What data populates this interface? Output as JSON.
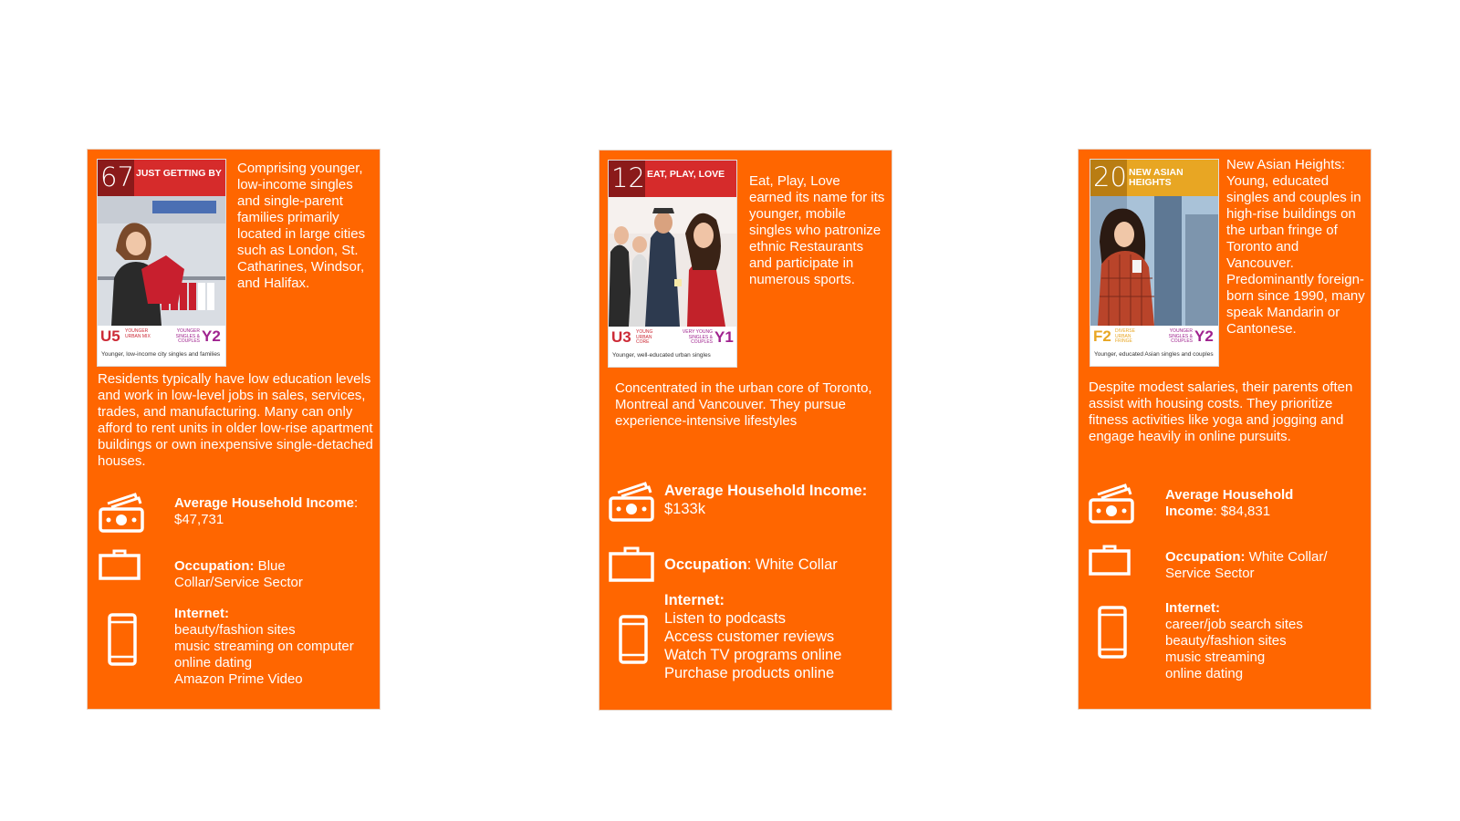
{
  "cards": [
    {
      "number": "67",
      "name": "JUST GETTING BY",
      "banner_color": "#d62b2b",
      "left_code": "U5",
      "left_code_sub": "YOUNGER URBAN MIX",
      "left_color": "#cc2a36",
      "right_code": "Y2",
      "right_code_sub": "YOUNGER SINGLES & COUPLES",
      "right_color": "#a0238f",
      "caption": "Younger, low-income city singles and families",
      "description": "Comprising younger, low-income singles and single-parent families primarily located in large cities such as London, St. Catharines, Windsor, and Halifax.",
      "paragraph": "Residents typically have low education levels and work in low-level jobs in sales, services, trades, and manufacturing. Many can only afford to rent units in older low-rise apartment buildings or own inexpensive single-detached houses.",
      "income_label": "Average Household Income",
      "income_value": ": $47,731",
      "occupation_label": "Occupation:",
      "occupation_value": " Blue Collar/Service Sector",
      "internet_label": "Internet:",
      "internet_items": [
        "beauty/fashion sites",
        "music streaming on computer",
        "online dating",
        "Amazon Prime Video"
      ]
    },
    {
      "number": "12",
      "name": "EAT, PLAY, LOVE",
      "banner_color": "#d62b2b",
      "left_code": "U3",
      "left_code_sub": "YOUNG URBAN CORE",
      "left_color": "#cc2a36",
      "right_code": "Y1",
      "right_code_sub": "VERY YOUNG SINGLES & COUPLES",
      "right_color": "#a0238f",
      "caption": "Younger, well-educated urban singles",
      "description": "Eat, Play, Love earned its name for its younger, mobile singles who patronize ethnic Restaurants and participate in numerous sports.",
      "paragraph": "Concentrated in the urban core of Toronto, Montreal and Vancouver. They pursue experience-intensive lifestyles",
      "income_label": "Average Household Income:",
      "income_value": "$133k",
      "occupation_label": "Occupation",
      "occupation_value": ": White Collar",
      "internet_label": "Internet:",
      "internet_items": [
        "Listen to podcasts",
        "Access customer reviews",
        "Watch TV programs online",
        "Purchase products online"
      ]
    },
    {
      "number": "20",
      "name": "NEW ASIAN HEIGHTS",
      "banner_color": "#e8a623",
      "left_code": "F2",
      "left_code_sub": "DIVERSE URBAN FRINGE",
      "left_color": "#e8a623",
      "right_code": "Y2",
      "right_code_sub": "YOUNGER SINGLES & COUPLES",
      "right_color": "#a0238f",
      "caption": "Younger, educated Asian singles and couples",
      "description": "New Asian Heights: Young, educated singles and couples in high-rise buildings on the urban fringe of Toronto and Vancouver. Predominantly foreign-born since 1990, many speak Mandarin or Cantonese.",
      "paragraph": "Despite modest salaries, their parents often assist with housing costs. They prioritize fitness activities like yoga and jogging and engage heavily in online pursuits.",
      "income_label": "Average Household Income",
      "income_value": ": $84,831",
      "occupation_label": "Occupation:",
      "occupation_value": " White Collar/ Service Sector",
      "internet_label": "Internet:",
      "internet_items": [
        "career/job search sites",
        "beauty/fashion sites",
        "music streaming",
        "online dating"
      ]
    }
  ],
  "icons": {
    "income": "money-icon",
    "occupation": "briefcase-icon",
    "internet": "smartphone-icon"
  },
  "colors": {
    "card_background": "#ff6600",
    "text": "#ffffff"
  }
}
